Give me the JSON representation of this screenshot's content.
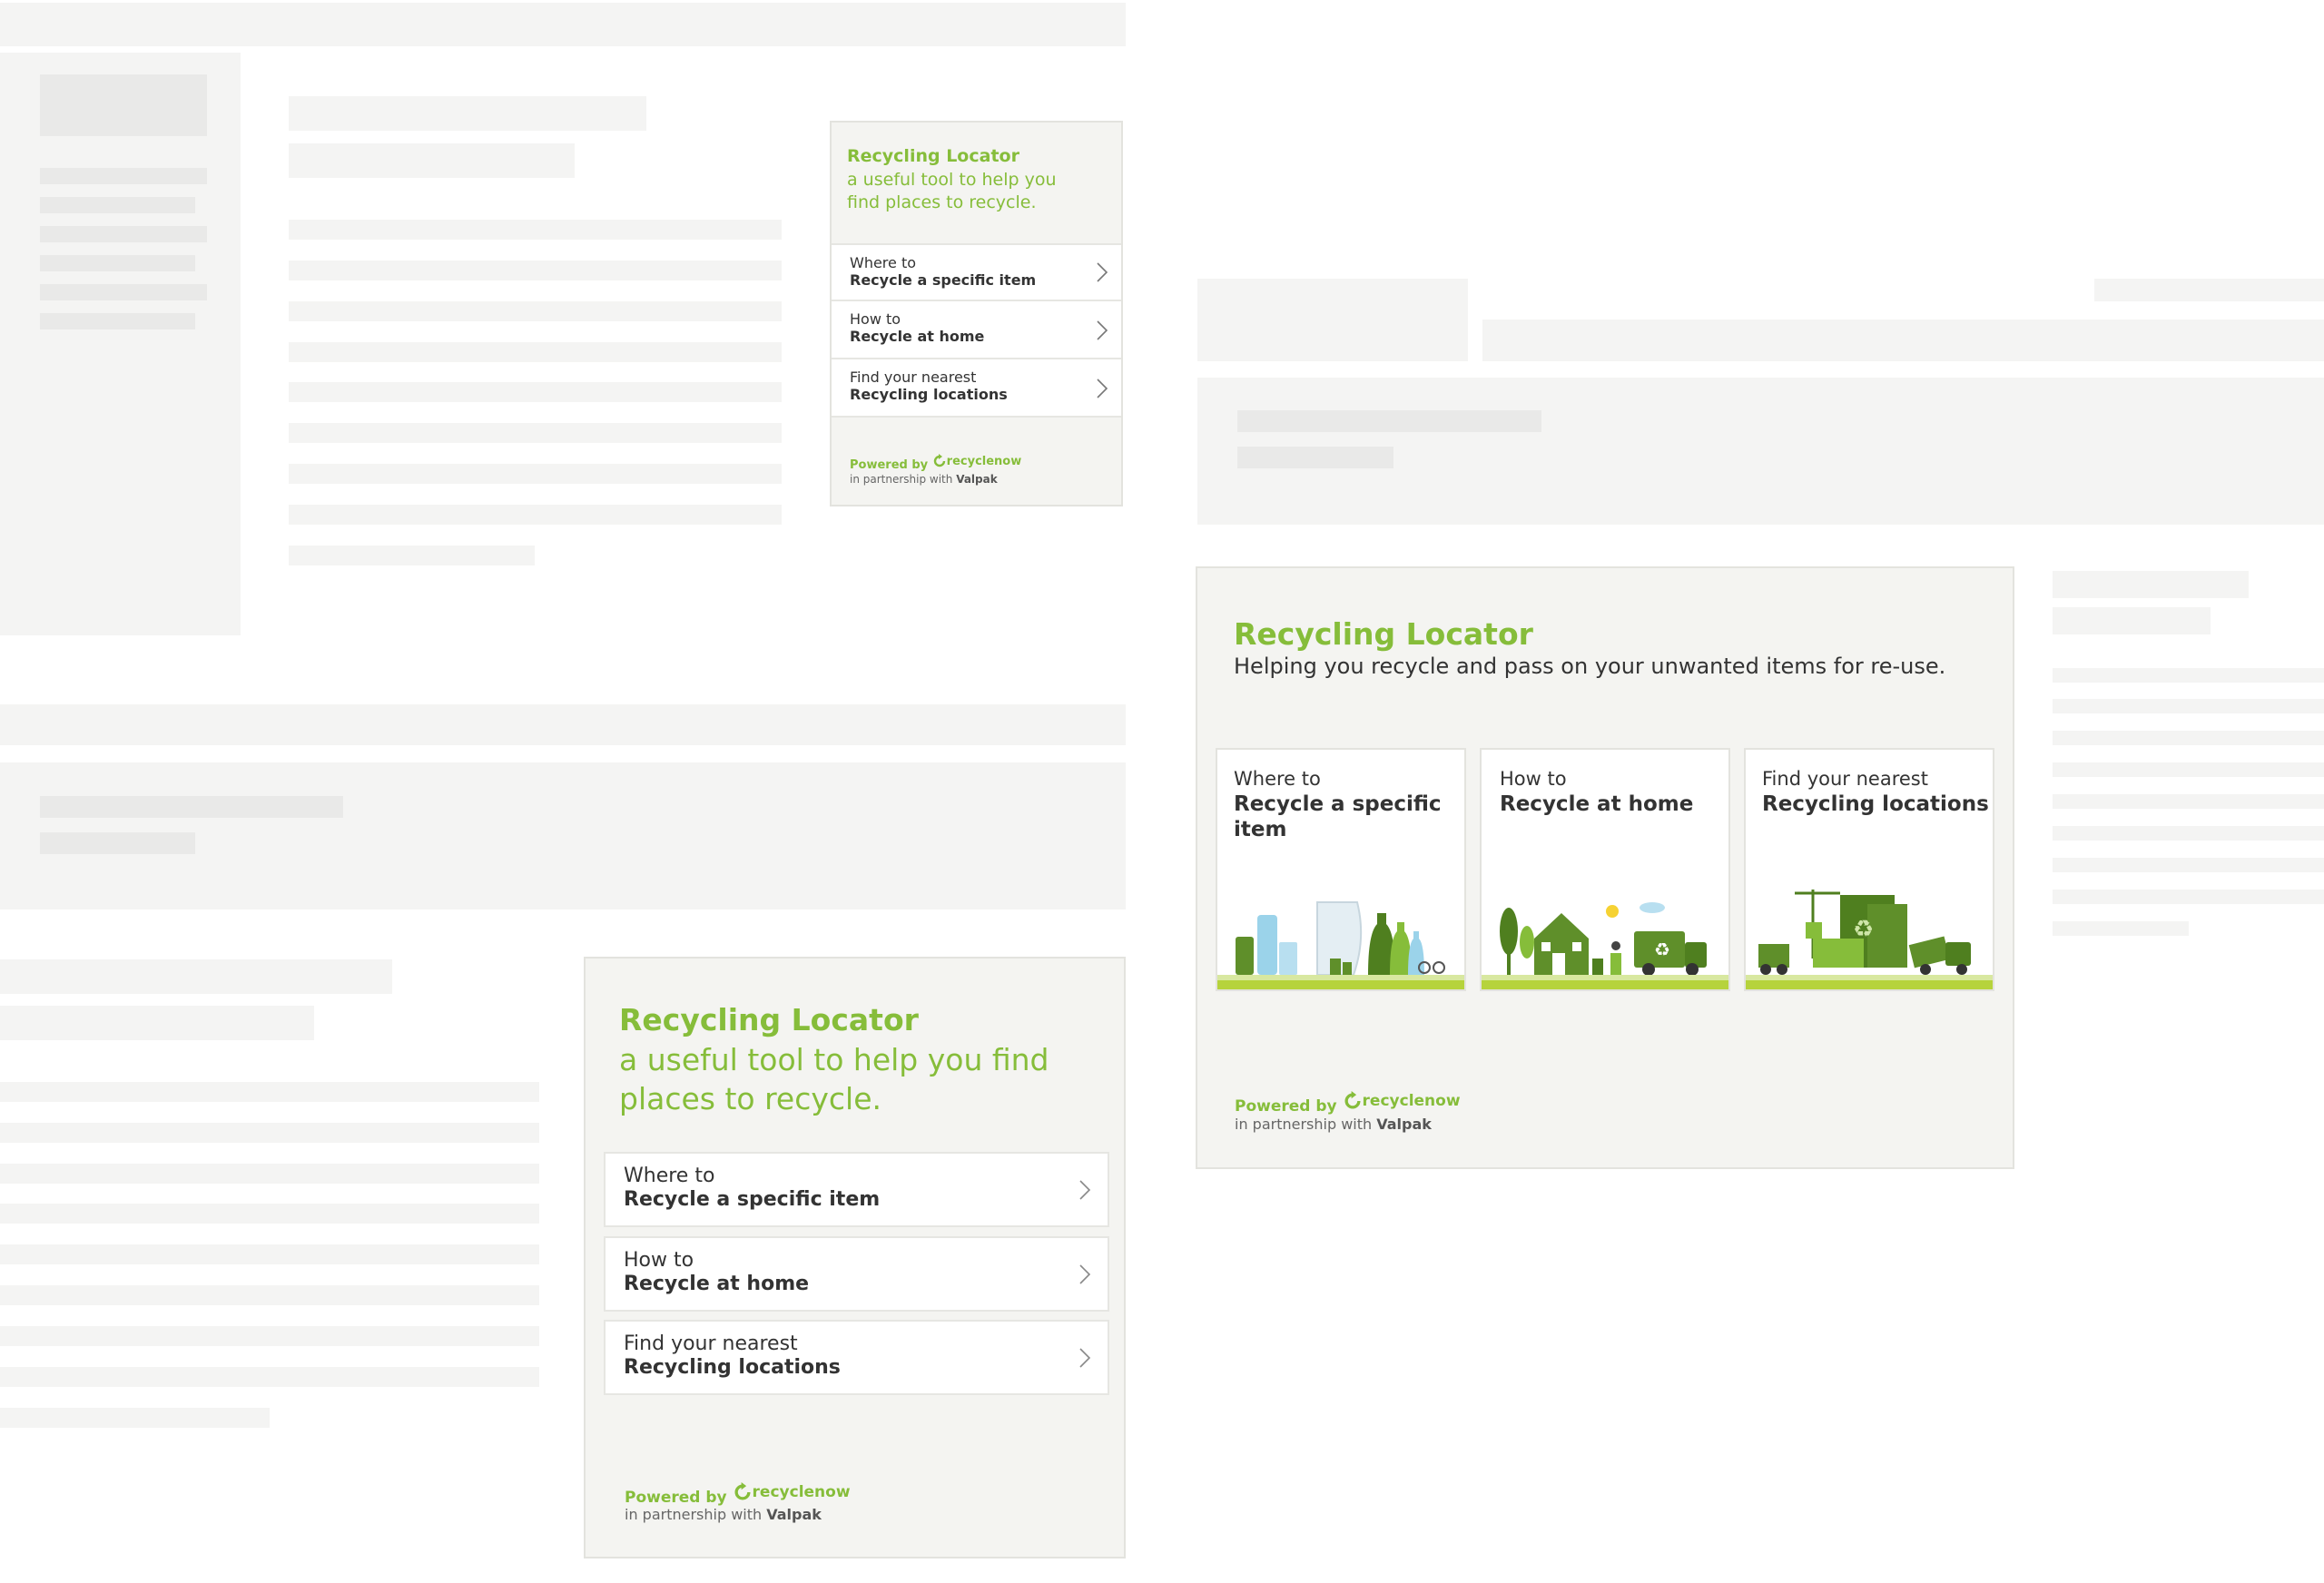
{
  "widget_small": {
    "title": "Recycling Locator",
    "subtitle": "a useful tool to help you find places to recycle.",
    "items": [
      {
        "top": "Where to",
        "bold": "Recycle a specific item"
      },
      {
        "top": "How to",
        "bold": "Recycle at home"
      },
      {
        "top": "Find your nearest",
        "bold": "Recycling locations"
      }
    ],
    "powered_label": "Powered by",
    "brand": "recyclenow",
    "partnership_prefix": "in partnership with",
    "partner_name": "Valpak"
  },
  "widget_medium": {
    "title": "Recycling Locator",
    "subtitle": "a useful tool to help you find places to recycle.",
    "items": [
      {
        "top": "Where to",
        "bold": "Recycle a specific item"
      },
      {
        "top": "How to",
        "bold": "Recycle at home"
      },
      {
        "top": "Find your nearest",
        "bold": "Recycling locations"
      }
    ],
    "powered_label": "Powered by",
    "brand": "recyclenow",
    "partnership_prefix": "in partnership with",
    "partner_name": "Valpak"
  },
  "widget_wide": {
    "title": "Recycling Locator",
    "subtitle": "Helping you recycle and pass on your unwanted items for re-use.",
    "cards": [
      {
        "top": "Where to",
        "bold": "Recycle a specific item",
        "icon": "recyclable-items-illustration"
      },
      {
        "top": "How to",
        "bold": "Recycle at home",
        "icon": "home-recycling-illustration"
      },
      {
        "top": "Find your nearest",
        "bold": "Recycling locations",
        "icon": "recycling-centre-illustration"
      }
    ],
    "powered_label": "Powered by",
    "brand": "recyclenow",
    "partnership_prefix": "in partnership with",
    "partner_name": "Valpak"
  },
  "colors": {
    "accent_green": "#86bd3a",
    "panel_bg": "#f4f4f1",
    "placeholder": "#f4f4f3",
    "placeholder_dark": "#e9e9e8"
  }
}
